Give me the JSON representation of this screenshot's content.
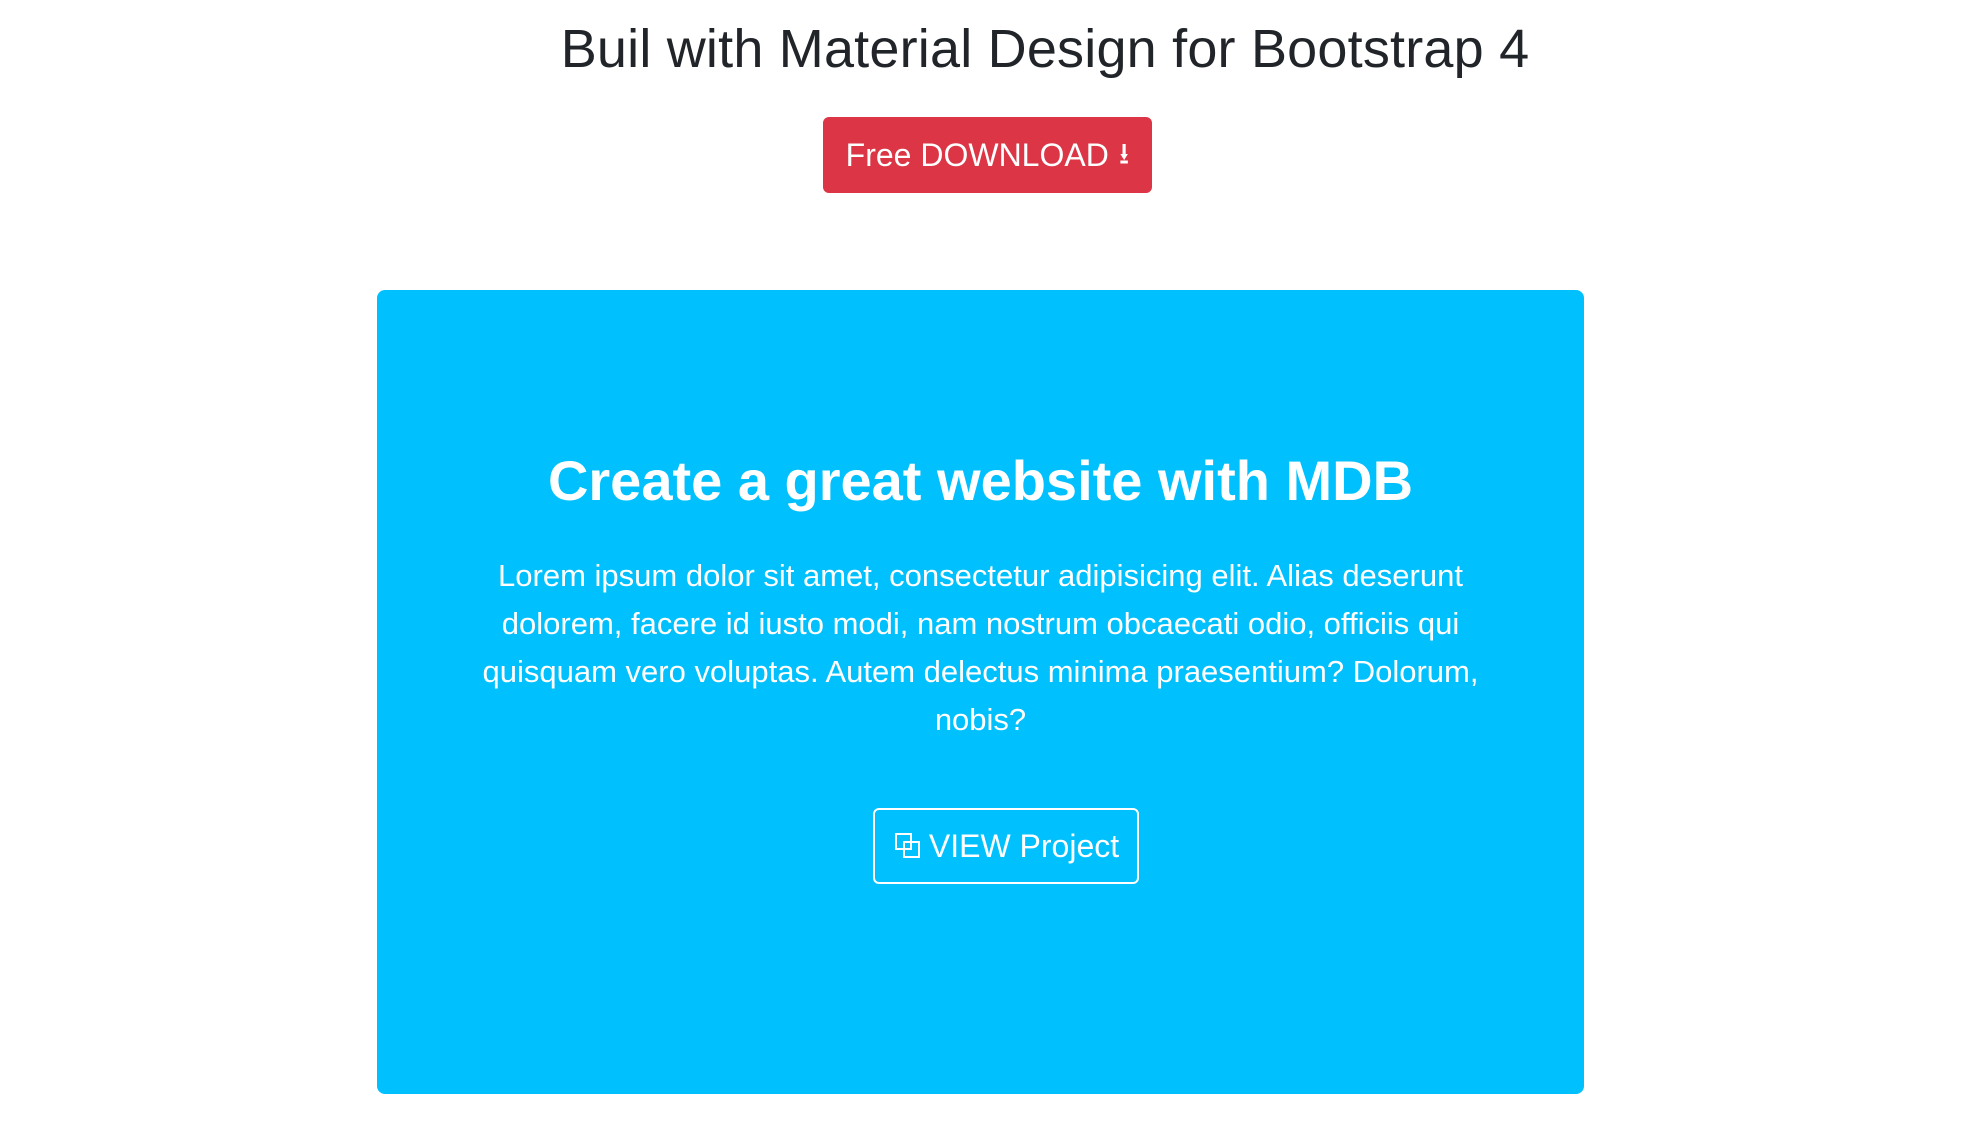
{
  "header": {
    "title": "Buil with Material Design for Bootstrap 4",
    "download_button": {
      "label": "Free DOWNLOAD",
      "icon": "download-arrow-icon",
      "icon_glyph": "⭳",
      "color": "#dc3545"
    }
  },
  "card": {
    "background_color": "#00c0fe",
    "title": "Create a great website with MDB",
    "text": "Lorem ipsum dolor sit amet, consectetur adipisicing elit. Alias deserunt dolorem, facere id iusto modi, nam nostrum obcaecati odio, officiis qui quisquam vero voluptas. Autem delectus minima praesentium? Dolorum, nobis?",
    "view_button": {
      "label": "VIEW Project",
      "icon": "clone-icon"
    }
  }
}
